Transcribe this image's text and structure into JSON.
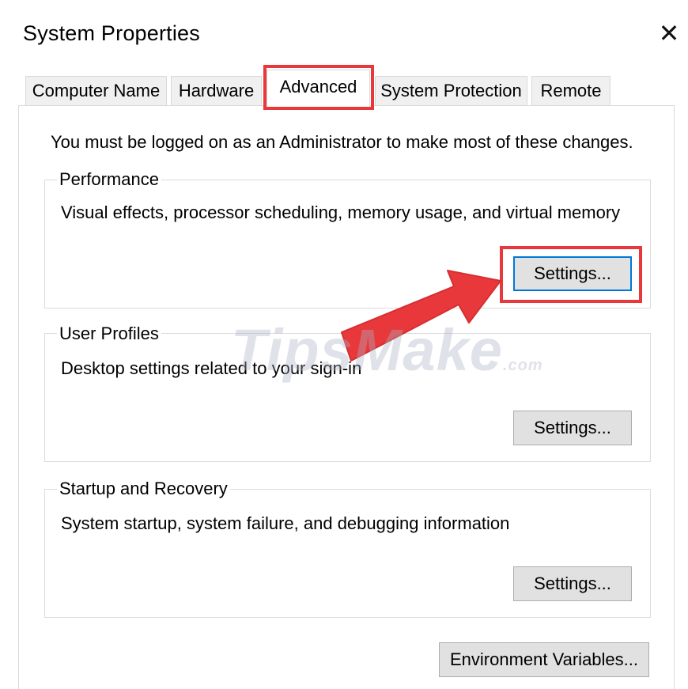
{
  "window": {
    "title": "System Properties",
    "close_glyph": "✕"
  },
  "tabs": [
    {
      "label": "Computer Name"
    },
    {
      "label": "Hardware"
    },
    {
      "label": "Advanced"
    },
    {
      "label": "System Protection"
    },
    {
      "label": "Remote"
    }
  ],
  "active_tab": "Advanced",
  "admin_note": "You must be logged on as an Administrator to make most of these changes.",
  "groups": {
    "performance": {
      "title": "Performance",
      "description": "Visual effects, processor scheduling, memory usage, and virtual memory",
      "button": "Settings..."
    },
    "user_profiles": {
      "title": "User Profiles",
      "description": "Desktop settings related to your sign-in",
      "button": "Settings..."
    },
    "startup_recovery": {
      "title": "Startup and Recovery",
      "description": "System startup, system failure, and debugging information",
      "button": "Settings..."
    }
  },
  "environment_button": "Environment Variables...",
  "watermark": {
    "main": "TipsMake",
    "suffix": ".com"
  },
  "colors": {
    "highlight": "#e8383b",
    "focus": "#0078d7"
  },
  "icons": {
    "close": "close-icon",
    "annotation": "arrow-annotation"
  }
}
